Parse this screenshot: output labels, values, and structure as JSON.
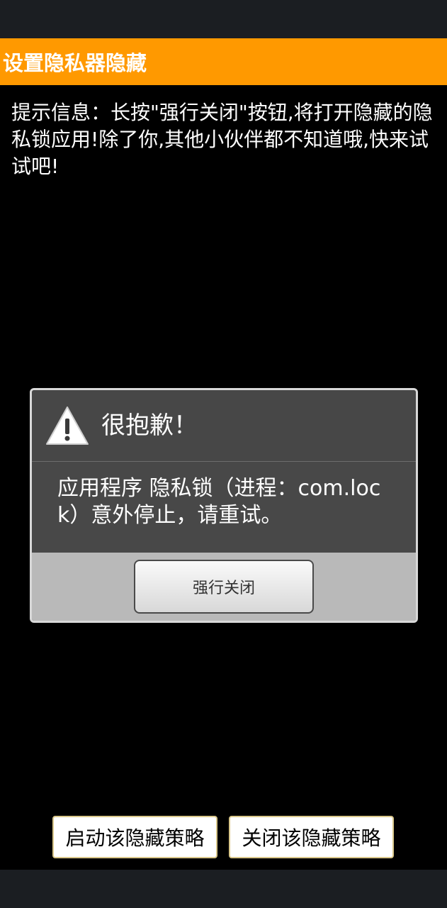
{
  "app": {
    "title": "设置隐私器隐藏"
  },
  "hint": {
    "text": "提示信息：长按\"强行关闭\"按钮,将打开隐藏的隐私锁应用!除了你,其他小伙伴都不知道哦,快来试试吧!"
  },
  "dialog": {
    "icon": "warning-icon",
    "title": "很抱歉！",
    "message": "应用程序 隐私锁（进程：com.lock）意外停止，请重试。",
    "button_label": "强行关闭"
  },
  "actions": {
    "start_label": "启动该隐藏策略",
    "stop_label": "关闭该隐藏策略"
  },
  "colors": {
    "title_bar": "#ff9900",
    "background": "#000000",
    "system_bars": "#1b1e22"
  }
}
